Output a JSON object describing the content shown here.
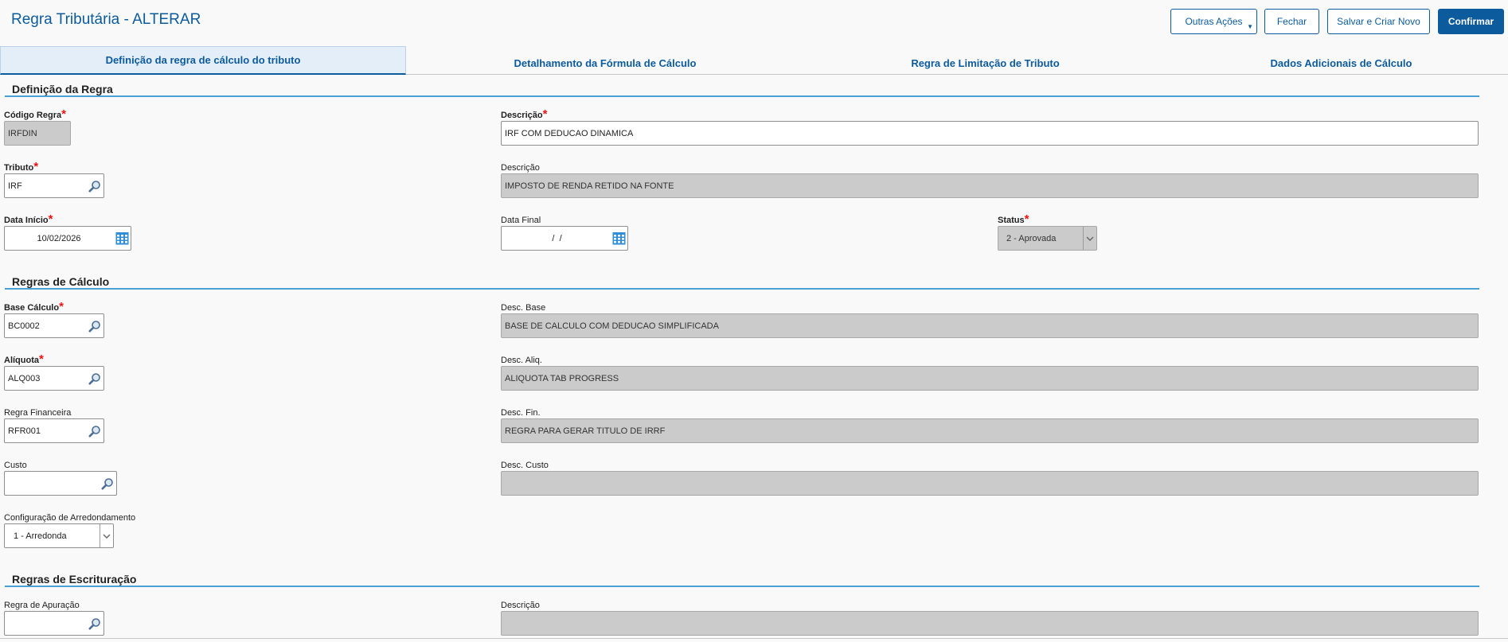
{
  "header": {
    "title": "Regra Tributária - ALTERAR",
    "buttons": {
      "other_actions": "Outras Ações",
      "close": "Fechar",
      "save_new": "Salvar e Criar Novo",
      "confirm": "Confirmar"
    }
  },
  "tabs": [
    {
      "label": "Definição da regra de cálculo do tributo",
      "active": true
    },
    {
      "label": "Detalhamento da Fórmula de Cálculo",
      "active": false
    },
    {
      "label": "Regra de Limitação de Tributo",
      "active": false
    },
    {
      "label": "Dados Adicionais de Cálculo",
      "active": false
    }
  ],
  "sections": {
    "definition": {
      "title": "Definição da Regra",
      "codigo_regra": {
        "label": "Código Regra",
        "value": "IRFDIN"
      },
      "descricao": {
        "label": "Descrição",
        "value": "IRF COM DEDUCAO DINAMICA"
      },
      "tributo": {
        "label": "Tributo",
        "value": "IRF"
      },
      "tributo_desc": {
        "label": "Descrição",
        "value": "IMPOSTO DE RENDA RETIDO NA FONTE"
      },
      "data_inicio": {
        "label": "Data Início",
        "value": "10/02/2026"
      },
      "data_final": {
        "label": "Data Final",
        "value": " /  /"
      },
      "status": {
        "label": "Status",
        "value": "2 - Aprovada"
      }
    },
    "calculation": {
      "title": "Regras de Cálculo",
      "base_calculo": {
        "label": "Base Cálculo",
        "value": "BC0002"
      },
      "desc_base": {
        "label": "Desc. Base",
        "value": "BASE DE CALCULO COM DEDUCAO SIMPLIFICADA"
      },
      "aliquota": {
        "label": "Alíquota",
        "value": "ALQ003"
      },
      "desc_aliq": {
        "label": "Desc. Aliq.",
        "value": "ALIQUOTA TAB PROGRESS"
      },
      "regra_financeira": {
        "label": "Regra Financeira",
        "value": "RFR001"
      },
      "desc_fin": {
        "label": "Desc. Fin.",
        "value": "REGRA PARA GERAR TITULO DE IRRF"
      },
      "custo": {
        "label": "Custo",
        "value": ""
      },
      "desc_custo": {
        "label": "Desc. Custo",
        "value": ""
      },
      "arredondamento": {
        "label": "Configuração de Arredondamento",
        "value": "1 - Arredonda"
      }
    },
    "bookkeeping": {
      "title": "Regras de Escrituração",
      "regra_apuracao": {
        "label": "Regra de Apuração",
        "value": ""
      },
      "descricao": {
        "label": "Descrição",
        "value": ""
      }
    }
  },
  "required_mark": "*",
  "colors": {
    "brand": "#0c5b9c",
    "section_line": "#4ba0d6",
    "required": "#e11111",
    "readonly_bg": "#cbcbcb"
  },
  "icons": {
    "lookup": "search-icon",
    "calendar": "calendar-icon",
    "dropdown": "chevron-down-icon"
  }
}
